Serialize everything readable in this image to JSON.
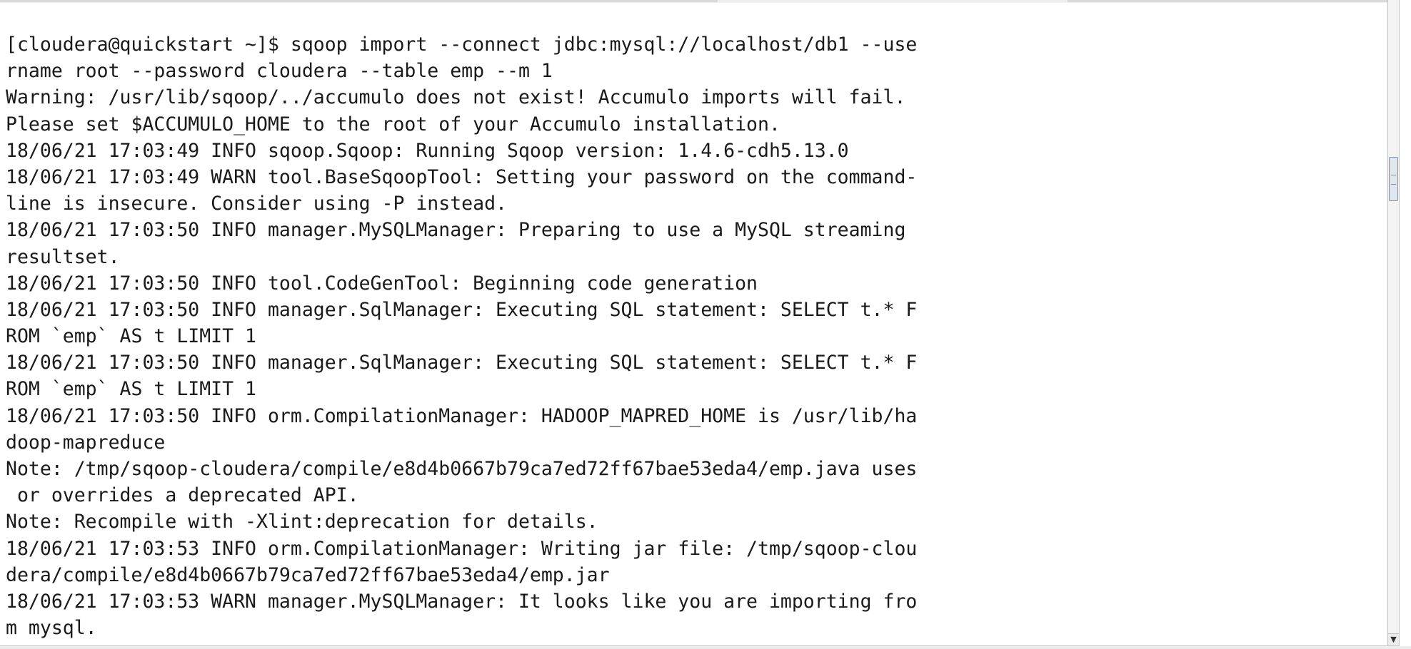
{
  "terminal": {
    "lines": [
      "[cloudera@quickstart ~]$ sqoop import --connect jdbc:mysql://localhost/db1 --use",
      "rname root --password cloudera --table emp --m 1",
      "Warning: /usr/lib/sqoop/../accumulo does not exist! Accumulo imports will fail.",
      "Please set $ACCUMULO_HOME to the root of your Accumulo installation.",
      "18/06/21 17:03:49 INFO sqoop.Sqoop: Running Sqoop version: 1.4.6-cdh5.13.0",
      "18/06/21 17:03:49 WARN tool.BaseSqoopTool: Setting your password on the command-",
      "line is insecure. Consider using -P instead.",
      "18/06/21 17:03:50 INFO manager.MySQLManager: Preparing to use a MySQL streaming",
      "resultset.",
      "18/06/21 17:03:50 INFO tool.CodeGenTool: Beginning code generation",
      "18/06/21 17:03:50 INFO manager.SqlManager: Executing SQL statement: SELECT t.* F",
      "ROM `emp` AS t LIMIT 1",
      "18/06/21 17:03:50 INFO manager.SqlManager: Executing SQL statement: SELECT t.* F",
      "ROM `emp` AS t LIMIT 1",
      "18/06/21 17:03:50 INFO orm.CompilationManager: HADOOP_MAPRED_HOME is /usr/lib/ha",
      "doop-mapreduce",
      "Note: /tmp/sqoop-cloudera/compile/e8d4b0667b79ca7ed72ff67bae53eda4/emp.java uses",
      " or overrides a deprecated API.",
      "Note: Recompile with -Xlint:deprecation for details.",
      "18/06/21 17:03:53 INFO orm.CompilationManager: Writing jar file: /tmp/sqoop-clou",
      "dera/compile/e8d4b0667b79ca7ed72ff67bae53eda4/emp.jar",
      "18/06/21 17:03:53 WARN manager.MySQLManager: It looks like you are importing fro",
      "m mysql."
    ]
  },
  "scrollbar": {
    "down_arrow": "▼"
  },
  "colors": {
    "background": "#ffffff",
    "text": "#1a1a1a",
    "scroll_thumb_border": "#7f95ae"
  }
}
